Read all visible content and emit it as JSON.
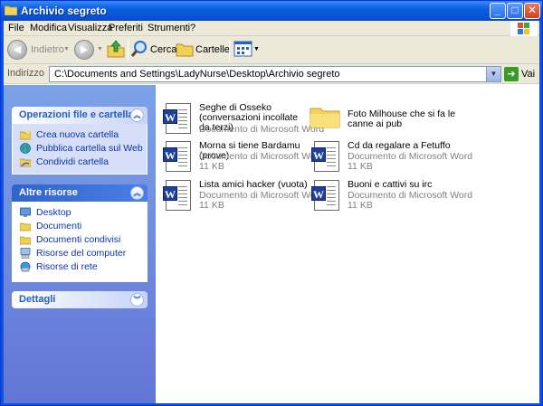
{
  "window": {
    "title": "Archivio segreto"
  },
  "menu": [
    "File",
    "Modifica",
    "Visualizza",
    "Preferiti",
    "Strumenti",
    "?"
  ],
  "toolbar": {
    "back_label": "Indietro",
    "search_label": "Cerca",
    "folders_label": "Cartelle"
  },
  "address": {
    "label": "Indirizzo",
    "value": "C:\\Documents and Settings\\LadyNurse\\Desktop\\Archivio segreto",
    "go_label": "Vai"
  },
  "panels": {
    "file_tasks": {
      "title": "Operazioni file e cartella",
      "items": [
        {
          "label": "Crea nuova cartella",
          "icon": "new-folder-icon"
        },
        {
          "label": "Pubblica cartella sul Web",
          "icon": "publish-web-icon"
        },
        {
          "label": "Condividi cartella",
          "icon": "share-folder-icon"
        }
      ]
    },
    "other_places": {
      "title": "Altre risorse",
      "items": [
        {
          "label": "Desktop",
          "icon": "desktop-icon"
        },
        {
          "label": "Documenti",
          "icon": "documents-folder-icon"
        },
        {
          "label": "Documenti condivisi",
          "icon": "shared-documents-icon"
        },
        {
          "label": "Risorse del computer",
          "icon": "my-computer-icon"
        },
        {
          "label": "Risorse di rete",
          "icon": "network-places-icon"
        }
      ]
    },
    "details": {
      "title": "Dettagli"
    }
  },
  "files": [
    {
      "name": "Seghe di Osseko (conversazioni incollate da terzi)",
      "type": "Documento di Microsoft Word",
      "size": "",
      "icon": "word-document-icon"
    },
    {
      "name": "Foto Milhouse che si fa le canne ai pub",
      "type": "",
      "size": "",
      "icon": "folder-icon"
    },
    {
      "name": "Morna si tiene Bardamu (prove)",
      "type": "Documento di Microsoft Word",
      "size": "11 KB",
      "icon": "word-document-icon"
    },
    {
      "name": "Cd da regalare a Fetuffo",
      "type": "Documento di Microsoft Word",
      "size": "11 KB",
      "icon": "word-document-icon"
    },
    {
      "name": "Lista amici hacker (vuota)",
      "type": "Documento di Microsoft Word",
      "size": "11 KB",
      "icon": "word-document-icon"
    },
    {
      "name": "Buoni e cattivi su irc",
      "type": "Documento di Microsoft Word",
      "size": "11 KB",
      "icon": "word-document-icon"
    }
  ]
}
